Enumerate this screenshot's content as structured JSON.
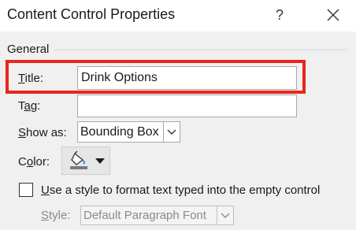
{
  "window": {
    "title": "Content Control Properties",
    "help_label": "?"
  },
  "icons": {
    "close": "close-icon",
    "paint_bucket": "paint-bucket-icon",
    "dropdown_arrow": "chevron-down-icon"
  },
  "colors": {
    "highlight": "#e8261e",
    "paint_swatch": "#7a7a7a"
  },
  "general": {
    "group_label": "General",
    "title_label_accel": "T",
    "title_label_rest": "itle:",
    "title_value": "Drink Options",
    "tag_label_pre": "T",
    "tag_label_accel": "a",
    "tag_label_rest": "g:",
    "tag_value": "",
    "show_as_label_accel": "S",
    "show_as_label_rest": "how as:",
    "show_as_value": "Bounding Box",
    "color_label_pre": "C",
    "color_label_accel": "o",
    "color_label_rest": "lor:",
    "use_style_label_accel": "U",
    "use_style_label_rest": "se a style to format text typed into the empty control",
    "use_style_checked": false,
    "style_label_accel": "S",
    "style_label_rest": "tyle:",
    "style_value": "Default Paragraph Font"
  }
}
